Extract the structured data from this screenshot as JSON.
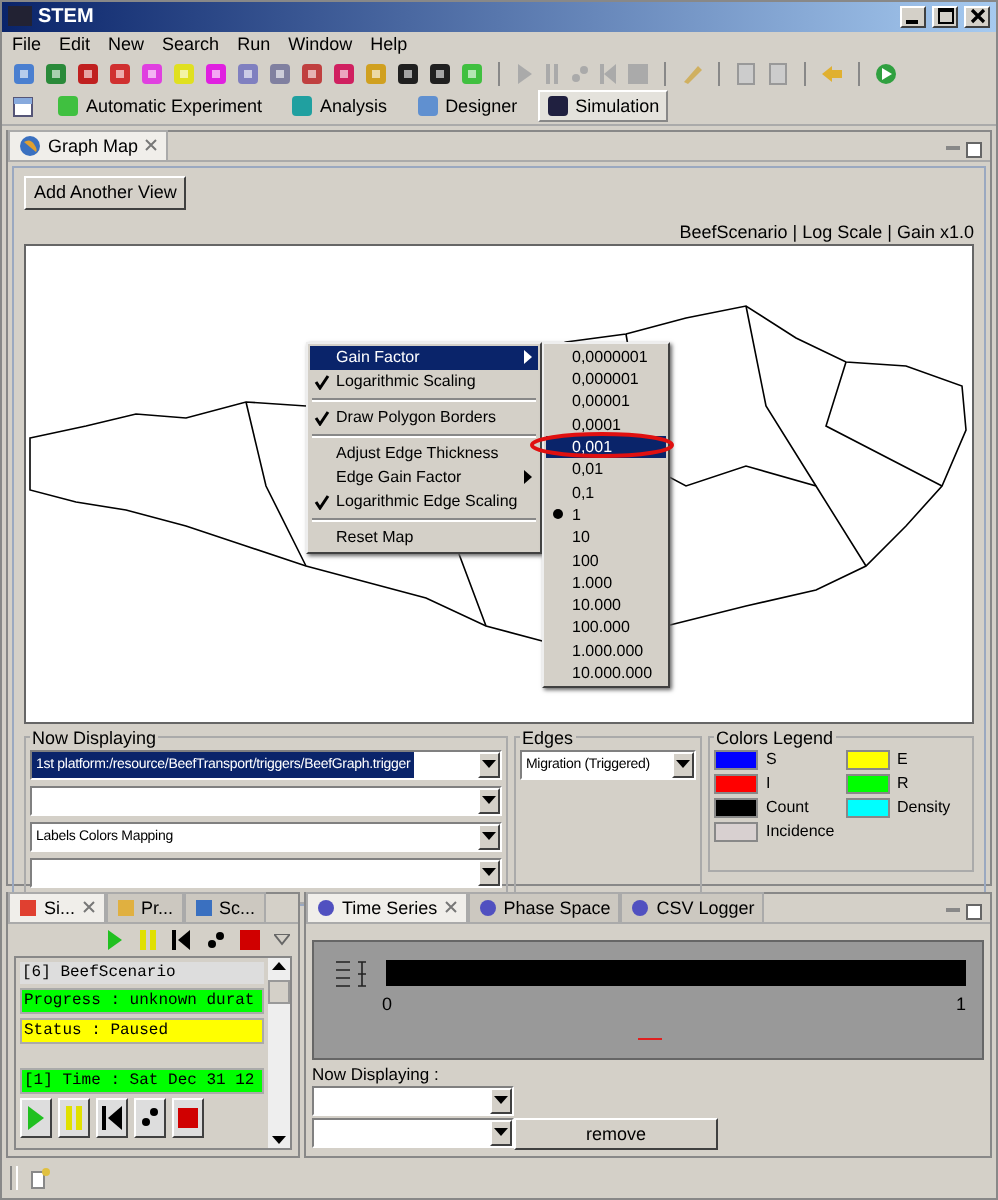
{
  "window": {
    "title": "STEM"
  },
  "menu": [
    "File",
    "Edit",
    "New",
    "Search",
    "Run",
    "Window",
    "Help"
  ],
  "perspectives": [
    {
      "label": "Automatic Experiment",
      "selected": false
    },
    {
      "label": "Analysis",
      "selected": false
    },
    {
      "label": "Designer",
      "selected": false
    },
    {
      "label": "Simulation",
      "selected": true
    }
  ],
  "graph_map": {
    "tab": "Graph Map",
    "add_button": "Add Another View",
    "info": "BeefScenario | Log Scale | Gain x1.0",
    "context_menu": [
      {
        "kind": "submenu",
        "label": "Gain Factor",
        "selected": true
      },
      {
        "kind": "check",
        "label": "Logarithmic Scaling",
        "checked": true,
        "selected": false
      },
      {
        "kind": "separator"
      },
      {
        "kind": "check",
        "label": "Draw Polygon Borders",
        "checked": true,
        "selected": false
      },
      {
        "kind": "separator"
      },
      {
        "kind": "action",
        "label": "Adjust Edge Thickness",
        "selected": false
      },
      {
        "kind": "submenu",
        "label": "Edge Gain Factor",
        "selected": false
      },
      {
        "kind": "check",
        "label": "Logarithmic Edge Scaling",
        "checked": true,
        "selected": false
      },
      {
        "kind": "separator"
      },
      {
        "kind": "action",
        "label": "Reset Map",
        "selected": false
      }
    ],
    "gain_submenu": [
      {
        "label": "0,0000001",
        "selected": false,
        "checked": false,
        "circled": false
      },
      {
        "label": "0,000001",
        "selected": false,
        "checked": false,
        "circled": false
      },
      {
        "label": "0,00001",
        "selected": false,
        "checked": false,
        "circled": false
      },
      {
        "label": "0,0001",
        "selected": false,
        "checked": false,
        "circled": false
      },
      {
        "label": "0,001",
        "selected": true,
        "checked": false,
        "circled": true
      },
      {
        "label": "0,01",
        "selected": false,
        "checked": false,
        "circled": false
      },
      {
        "label": "0,1",
        "selected": false,
        "checked": false,
        "circled": false
      },
      {
        "label": "1",
        "selected": false,
        "checked": true,
        "circled": false
      },
      {
        "label": "10",
        "selected": false,
        "checked": false,
        "circled": false
      },
      {
        "label": "100",
        "selected": false,
        "checked": false,
        "circled": false
      },
      {
        "label": "1.000",
        "selected": false,
        "checked": false,
        "circled": false
      },
      {
        "label": "10.000",
        "selected": false,
        "checked": false,
        "circled": false
      },
      {
        "label": "100.000",
        "selected": false,
        "checked": false,
        "circled": false
      },
      {
        "label": "1.000.000",
        "selected": false,
        "checked": false,
        "circled": false
      },
      {
        "label": "10.000.000",
        "selected": false,
        "checked": false,
        "circled": false
      }
    ]
  },
  "now_displaying": {
    "title": "Now Displaying",
    "fields": [
      {
        "value": "1st platform:/resource/BeefTransport/triggers/BeefGraph.trigger",
        "selected": true
      },
      {
        "selected": false
      },
      {
        "value": "Labels Colors Mapping",
        "selected": false
      },
      {
        "selected": false
      }
    ]
  },
  "edges": {
    "title": "Edges",
    "value": "Migration (Triggered)"
  },
  "legend": {
    "title": "Colors Legend",
    "items": [
      {
        "label": "S",
        "color": "#0000ff"
      },
      {
        "label": "E",
        "color": "#ffff00"
      },
      {
        "label": "I",
        "color": "#ff0000"
      },
      {
        "label": "R",
        "color": "#00ff00"
      },
      {
        "label": "Count",
        "color": "#000000"
      },
      {
        "label": "Density",
        "color": "#00ffff"
      },
      {
        "label": "Incidence",
        "color": "#d8d0d0"
      }
    ]
  },
  "simulation": {
    "tabs": [
      {
        "label": "Si...",
        "selected": true
      },
      {
        "label": "Pr...",
        "selected": false
      },
      {
        "label": "Sc...",
        "selected": false
      }
    ],
    "scenario": "[6] BeefScenario",
    "lines": [
      {
        "text": "Progress : unknown durat",
        "color": "#00ff00"
      },
      {
        "text": "Status : Paused",
        "color": "#ffff00"
      }
    ],
    "time": {
      "text": "[1] Time : Sat Dec 31 12",
      "color": "#00ff00"
    }
  },
  "time_series": {
    "tabs": [
      {
        "label": "Time Series",
        "selected": true
      },
      {
        "label": "Phase Space",
        "selected": false
      },
      {
        "label": "CSV Logger",
        "selected": false
      }
    ],
    "x_ticks": [
      "0",
      "1"
    ],
    "now_displaying": "Now Displaying :",
    "remove_button": "remove"
  }
}
